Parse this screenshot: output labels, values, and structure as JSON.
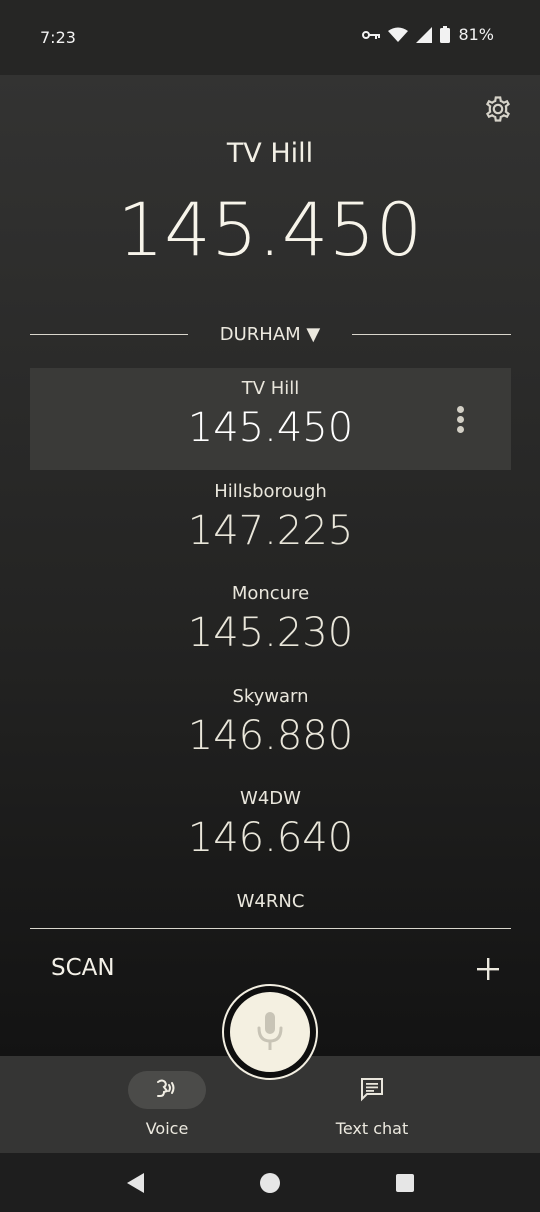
{
  "status": {
    "time": "7:23",
    "battery": "81%",
    "icons": [
      "vpn-key-icon",
      "wifi-icon",
      "cell-signal-icon",
      "battery-icon"
    ]
  },
  "header": {
    "current_name": "TV Hill",
    "current_freq": "145.450",
    "settings_icon": "gear-icon"
  },
  "group": {
    "label": "DURHAM ▼"
  },
  "channels": [
    {
      "name": "TV Hill",
      "freq": "145.450",
      "selected": true
    },
    {
      "name": "Hillsborough",
      "freq": "147.225"
    },
    {
      "name": "Moncure",
      "freq": "145.230"
    },
    {
      "name": "Skywarn",
      "freq": "146.880"
    },
    {
      "name": "W4DW",
      "freq": "146.640"
    },
    {
      "name": "W4RNC"
    }
  ],
  "scan": {
    "label": "SCAN",
    "add_icon": "plus-icon"
  },
  "bottom_nav": {
    "voice_label": "Voice",
    "text_chat_label": "Text chat"
  },
  "colors": {
    "accent_cream": "#f4f0e1",
    "background_dark": "#1a1a19",
    "nav_bar": "#353534"
  }
}
